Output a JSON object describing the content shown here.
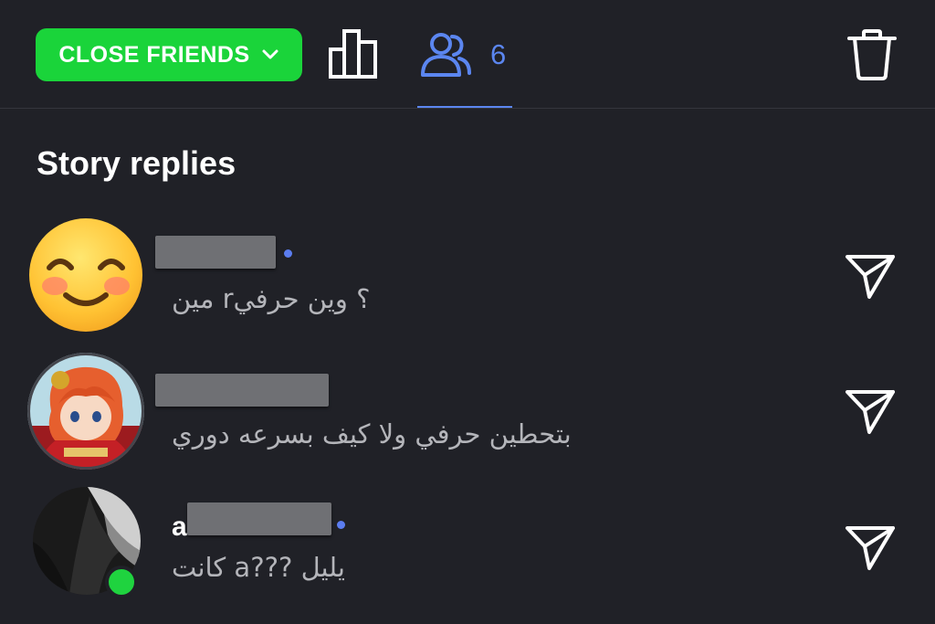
{
  "header": {
    "audience_label": "CLOSE FRIENDS",
    "audience_color": "#1ad43a",
    "stats_icon": "bar-chart-icon",
    "viewers_icon": "people-icon",
    "viewers_count": "6",
    "active_tab_color": "#5b86f0",
    "delete_icon": "trash-icon"
  },
  "section": {
    "title": "Story replies"
  },
  "replies": [
    {
      "avatar": "smiling-emoji-avatar",
      "username_prefix": "",
      "username_redacted": true,
      "unread": true,
      "message": "مين r؟ وين حرفي",
      "action_icon": "send-icon"
    },
    {
      "avatar": "anime-character-avatar",
      "username_prefix": "",
      "username_redacted": true,
      "unread": false,
      "message": "بتحطين حرفي ولا كيف بسرعه دوري",
      "action_icon": "send-icon"
    },
    {
      "avatar": "black-and-white-photo-avatar",
      "username_prefix": "a",
      "username_redacted": true,
      "unread": true,
      "online": true,
      "message": "كانت a??? يليل",
      "action_icon": "send-icon"
    }
  ]
}
